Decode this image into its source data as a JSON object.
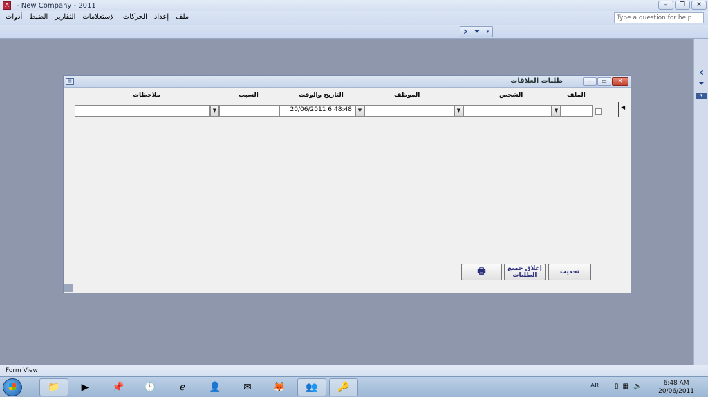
{
  "window": {
    "title": "- New Company - 2011"
  },
  "menu": {
    "items": [
      "ملف",
      "إعداد",
      "الحركات",
      "الإستعلامات",
      "التقارير",
      "الضبط",
      "أدوات"
    ]
  },
  "help": {
    "placeholder": "Type a question for help"
  },
  "form": {
    "title": "طلبات العلاقات",
    "columns": {
      "remarks": "ملاحظات",
      "reason": "السبب",
      "datetime": "التاريخ والوقت",
      "employee": "الموظف",
      "person": "الشخص",
      "company": "الملف"
    },
    "row": {
      "remarks": "",
      "reason": "",
      "datetime": "20/06/2011 6:48:48",
      "employee": "",
      "person": "",
      "company": ""
    },
    "buttons": {
      "refresh": "تحديث",
      "close_all": "إغلاق جميع الطلبات",
      "print_icon": "printer-icon"
    }
  },
  "status": {
    "text": "Form View"
  },
  "tray": {
    "lang": "AR",
    "time": "6:48 AM",
    "date": "20/06/2011"
  }
}
